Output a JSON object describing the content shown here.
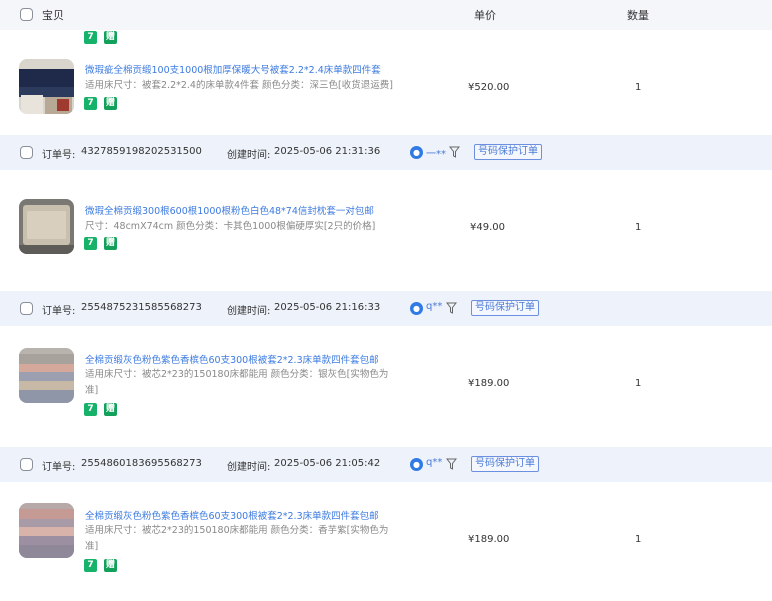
{
  "header": {
    "item_label": "宝贝",
    "price_label": "单价",
    "qty_label": "数量"
  },
  "tags": {
    "seven_days": "7",
    "gift": "赠"
  },
  "top_item": {
    "title": "微瑕疵全棉贡缎100支1000根加厚保暖大号被套2.2*2.4床单款四件套",
    "spec": "适用床尺寸：被套2.2*2.4的床单款4件套   颜色分类：深三色[收货退运费]",
    "price": "¥520.00",
    "qty": "1"
  },
  "orders": [
    {
      "order_no_label": "订单号:",
      "order_no": "4327859198202531500",
      "created_label": "创建时间:",
      "created_time": "2025-05-06 21:31:36",
      "buyer": "一**",
      "protect": "号码保护订单",
      "item": {
        "title": "微瑕全棉贡缎300根600根1000根粉色白色48*74信封枕套一对包邮",
        "spec": "尺寸：48cmX74cm   颜色分类：卡其色1000根偏硬厚实[2只的价格]",
        "price": "¥49.00",
        "qty": "1"
      }
    },
    {
      "order_no_label": "订单号:",
      "order_no": "2554875231585568273",
      "created_label": "创建时间:",
      "created_time": "2025-05-06 21:16:33",
      "buyer": "q**",
      "protect": "号码保护订单",
      "item": {
        "title": "全棉贡缎灰色粉色紫色香槟色60支300根被套2*2.3床单款四件套包邮",
        "spec": "适用床尺寸：被芯2*23的150180床都能用   颜色分类：银灰色[实物色为准]",
        "price": "¥189.00",
        "qty": "1"
      }
    },
    {
      "order_no_label": "订单号:",
      "order_no": "2554860183695568273",
      "created_label": "创建时间:",
      "created_time": "2025-05-06 21:05:42",
      "buyer": "q**",
      "protect": "号码保护订单",
      "item": {
        "title": "全棉贡缎灰色粉色紫色香槟色60支300根被套2*2.3床单款四件套包邮",
        "spec": "适用床尺寸：被芯2*23的150180床都能用   颜色分类：香芋紫[实物色为准]",
        "price": "¥189.00",
        "qty": "1"
      }
    }
  ]
}
